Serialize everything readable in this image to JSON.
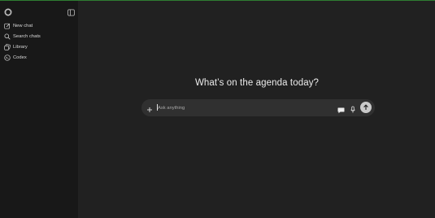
{
  "sidebar": {
    "items": [
      {
        "label": "New chat",
        "icon": "pencil-square-icon"
      },
      {
        "label": "Search chats",
        "icon": "search-icon"
      },
      {
        "label": "Library",
        "icon": "images-icon"
      },
      {
        "label": "Codex",
        "icon": "codex-icon"
      }
    ]
  },
  "main": {
    "headline": "What’s on the agenda today?",
    "composer": {
      "placeholder": "Ask anything"
    }
  },
  "colors": {
    "background": "#212121",
    "sidebar": "#181818",
    "composer": "#303030",
    "send_button": "#c9c9c9",
    "top_accent": "#2e7d32"
  }
}
